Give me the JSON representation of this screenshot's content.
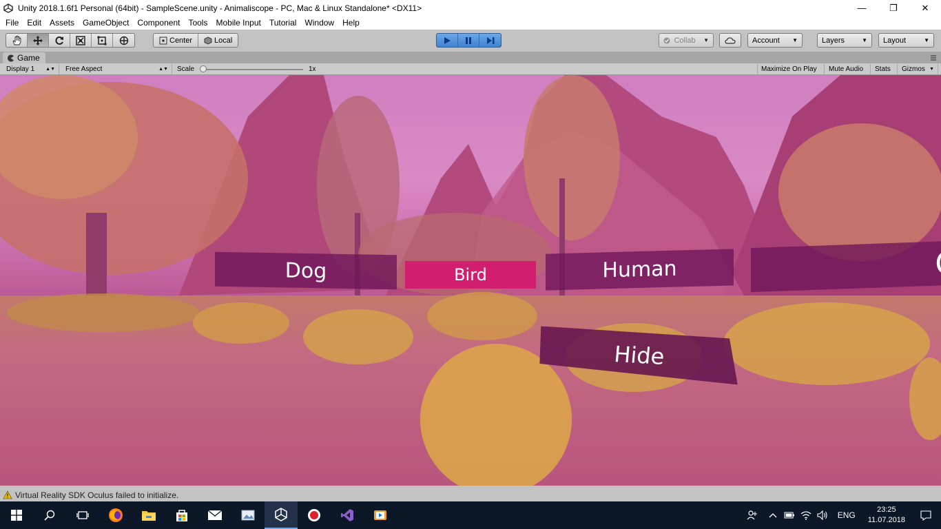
{
  "window": {
    "title": "Unity 2018.1.6f1 Personal (64bit) - SampleScene.unity - Animaliscope - PC, Mac & Linux Standalone* <DX11>",
    "minimize": "—",
    "maximize": "❐",
    "close": "✕"
  },
  "menu": {
    "items": [
      "File",
      "Edit",
      "Assets",
      "GameObject",
      "Component",
      "Tools",
      "Mobile Input",
      "Tutorial",
      "Window",
      "Help"
    ]
  },
  "toolbar": {
    "pivot_center": "Center",
    "pivot_local": "Local",
    "collab": "Collab",
    "account": "Account",
    "layers": "Layers",
    "layout": "Layout",
    "play_state": "playing"
  },
  "game_view": {
    "tab_label": "Game",
    "display": "Display 1",
    "aspect": "Free Aspect",
    "scale_label": "Scale",
    "scale_value": "1x",
    "scale_fraction": 0,
    "maximize_on_play": "Maximize On Play",
    "mute_audio": "Mute Audio",
    "stats": "Stats",
    "gizmos": "Gizmos"
  },
  "scene_ui": {
    "dog": "Dog",
    "bird": "Bird",
    "human": "Human",
    "partial": "O",
    "hide": "Hide",
    "selected": "Bird"
  },
  "status": {
    "message": "Virtual Reality SDK Oculus failed to initialize."
  },
  "taskbar": {
    "language": "ENG",
    "time": "23:25",
    "date": "11.07.2018"
  },
  "colors": {
    "editor_bg": "#c2c2c2",
    "play_blue": "#3f82cf",
    "selected_panel": "#d21e6e",
    "panel": "#6e145a",
    "taskbar": "#0c1727"
  }
}
